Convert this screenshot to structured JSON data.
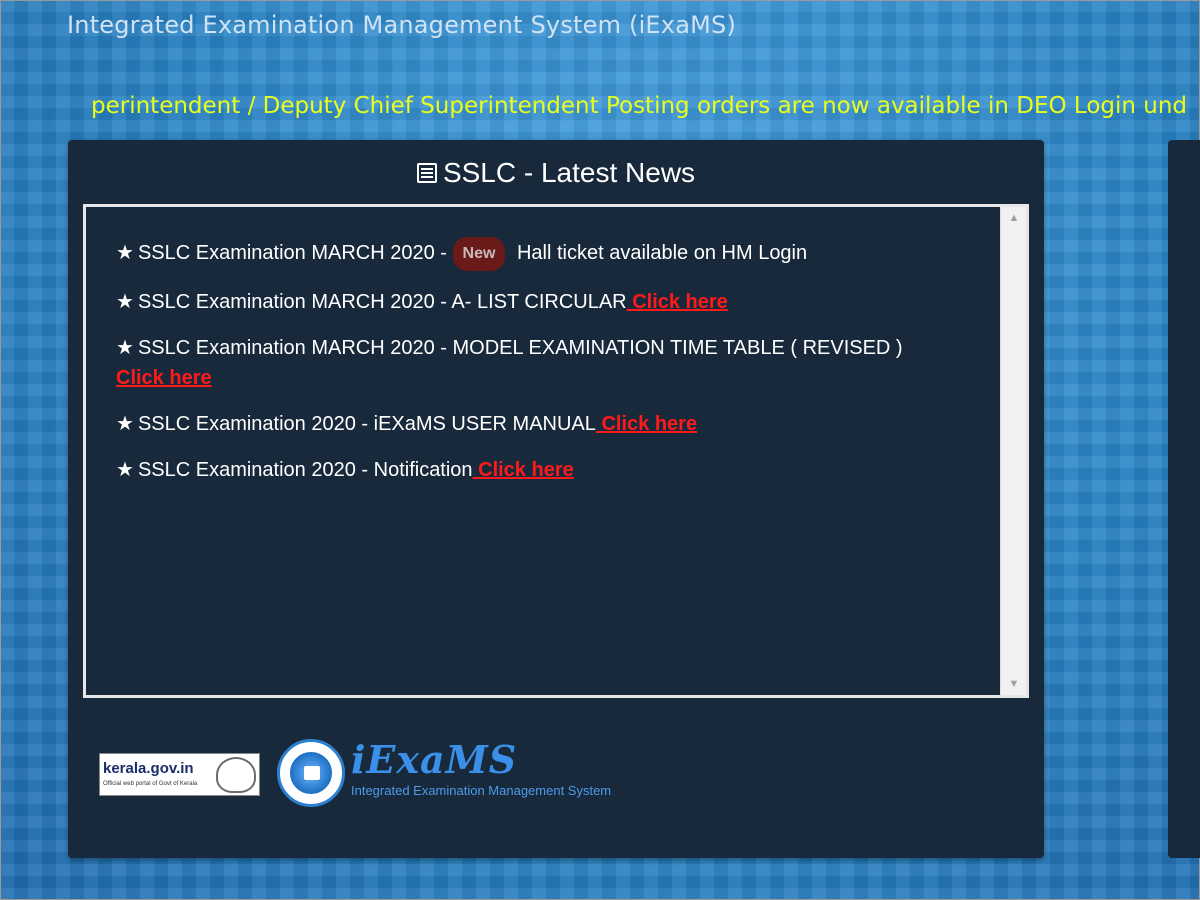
{
  "header": {
    "title": "Integrated Examination Management System (iExaMS)"
  },
  "ticker": {
    "text": "perintendent / Deputy Chief Superintendent Posting orders are now available in DEO Login und"
  },
  "news_panel": {
    "title": "SSLC - Latest News",
    "icon": "list-icon",
    "items": [
      {
        "prefix": "SSLC Examination MARCH 2020 - ",
        "badge": "New",
        "text": " Hall ticket available on HM Login",
        "link": ""
      },
      {
        "prefix": "SSLC Examination MARCH 2020 -  A- LIST CIRCULAR",
        "badge": "",
        "text": "",
        "link": " Click here"
      },
      {
        "prefix": "SSLC Examination MARCH 2020 -   MODEL EXAMINATION TIME TABLE ( REVISED )",
        "badge": "",
        "text": "",
        "link": " Click here"
      },
      {
        "prefix": "SSLC Examination 2020 - iEXaMS USER MANUAL",
        "badge": "",
        "text": "",
        "link": " Click here"
      },
      {
        "prefix": "SSLC Examination 2020 - Notification",
        "badge": "",
        "text": "",
        "link": " Click here"
      }
    ]
  },
  "footer": {
    "kerala_logo_text": "kerala.gov.in",
    "kerala_logo_sub": "Official web portal of Govt of Kerala",
    "iexams_name": "iExaMS",
    "iexams_tagline": "Integrated Examination Management System"
  },
  "colors": {
    "background": "#2f86c8",
    "panel": "#17293b",
    "ticker": "#e8ff1e",
    "link": "#ff1a1a",
    "badge": "#6b1a1a"
  }
}
